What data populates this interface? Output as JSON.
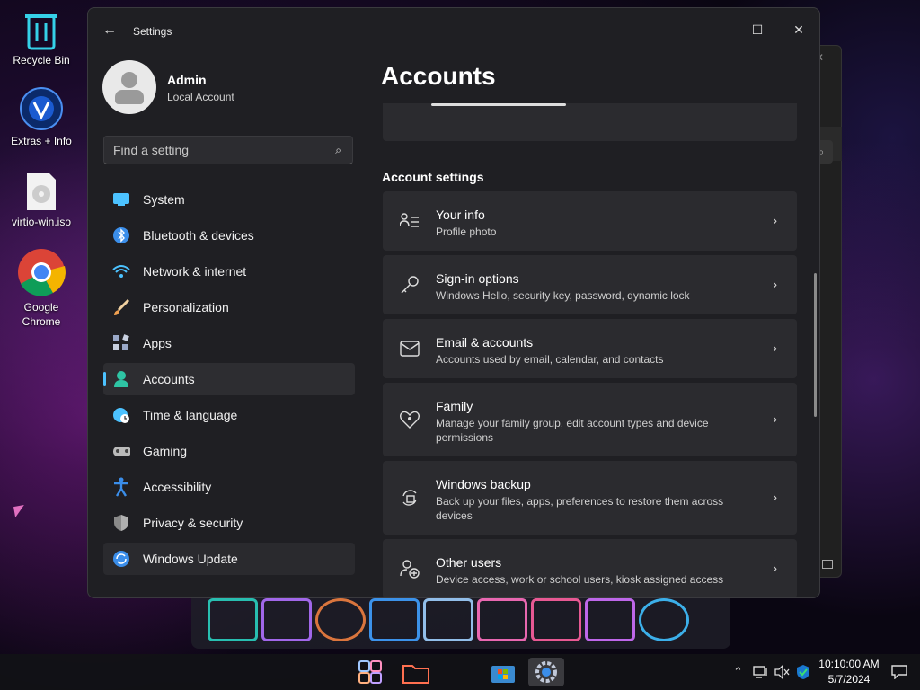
{
  "desktop": {
    "icons": [
      {
        "label": "Recycle Bin",
        "icon": "recycle-bin-icon"
      },
      {
        "label": "Extras + Info",
        "icon": "extras-icon"
      },
      {
        "label": "virtio-win.iso",
        "icon": "disc-image-icon"
      },
      {
        "label": "Google Chrome",
        "icon": "chrome-icon"
      }
    ]
  },
  "window": {
    "title": "Settings",
    "controls": [
      "minimize-icon",
      "maximize-icon",
      "close-icon"
    ]
  },
  "profile": {
    "name": "Admin",
    "account_type": "Local Account"
  },
  "search": {
    "placeholder": "Find a setting"
  },
  "nav": {
    "items": [
      {
        "label": "System",
        "icon": "monitor-icon",
        "color": "#4cc2ff"
      },
      {
        "label": "Bluetooth & devices",
        "icon": "bluetooth-icon",
        "color": "#3b8eea"
      },
      {
        "label": "Network & internet",
        "icon": "wifi-icon",
        "color": "#4cc2ff"
      },
      {
        "label": "Personalization",
        "icon": "brush-icon",
        "color": "#f0a050"
      },
      {
        "label": "Apps",
        "icon": "apps-icon",
        "color": "#9aa8c8"
      },
      {
        "label": "Accounts",
        "icon": "person-icon",
        "color": "#2ec4a4"
      },
      {
        "label": "Time & language",
        "icon": "globe-clock-icon",
        "color": "#4cc2ff"
      },
      {
        "label": "Gaming",
        "icon": "gamepad-icon",
        "color": "#bbbbbb"
      },
      {
        "label": "Accessibility",
        "icon": "accessibility-icon",
        "color": "#3b8eea"
      },
      {
        "label": "Privacy & security",
        "icon": "shield-icon",
        "color": "#8a8a8a"
      },
      {
        "label": "Windows Update",
        "icon": "update-icon",
        "color": "#3b8eea"
      }
    ],
    "selected": "Accounts",
    "hovered": "Windows Update"
  },
  "main": {
    "title": "Accounts",
    "section": "Account settings",
    "cards": [
      {
        "title": "Your info",
        "desc": "Profile photo",
        "icon": "person-lines-icon"
      },
      {
        "title": "Sign-in options",
        "desc": "Windows Hello, security key, password, dynamic lock",
        "icon": "key-icon"
      },
      {
        "title": "Email & accounts",
        "desc": "Accounts used by email, calendar, and contacts",
        "icon": "mail-icon"
      },
      {
        "title": "Family",
        "desc": "Manage your family group, edit account types and device permissions",
        "icon": "heart-people-icon"
      },
      {
        "title": "Windows backup",
        "desc": "Back up your files, apps, preferences to restore them across devices",
        "icon": "backup-icon"
      },
      {
        "title": "Other users",
        "desc": "Device access, work or school users, kiosk assigned access",
        "icon": "person-add-icon"
      }
    ]
  },
  "taskbar": {
    "apps": [
      "start-icon",
      "file-explorer-icon",
      "store-icon",
      "settings-icon"
    ],
    "active": "settings-icon",
    "clock": {
      "time": "10:10:00 AM",
      "date": "5/7/2024"
    }
  }
}
